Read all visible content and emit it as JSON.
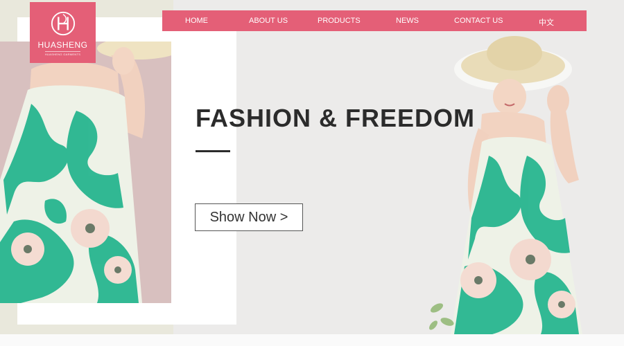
{
  "brand": {
    "name": "HUASHENG",
    "tagline": "HUASHENG GARMENTS",
    "color": "#e45f77"
  },
  "nav": {
    "items": [
      {
        "label": "HOME"
      },
      {
        "label": "ABOUT US"
      },
      {
        "label": "PRODUCTS"
      },
      {
        "label": "NEWS"
      },
      {
        "label": "CONTACT US"
      },
      {
        "label": "中文"
      }
    ]
  },
  "hero": {
    "headline": "FASHION & FREEDOM",
    "cta_label": "Show Now >"
  },
  "colors": {
    "accent": "#e45f77",
    "dress_green": "#27b58f",
    "dress_cream": "#eef2e7",
    "hat": "#e9dcb8"
  }
}
